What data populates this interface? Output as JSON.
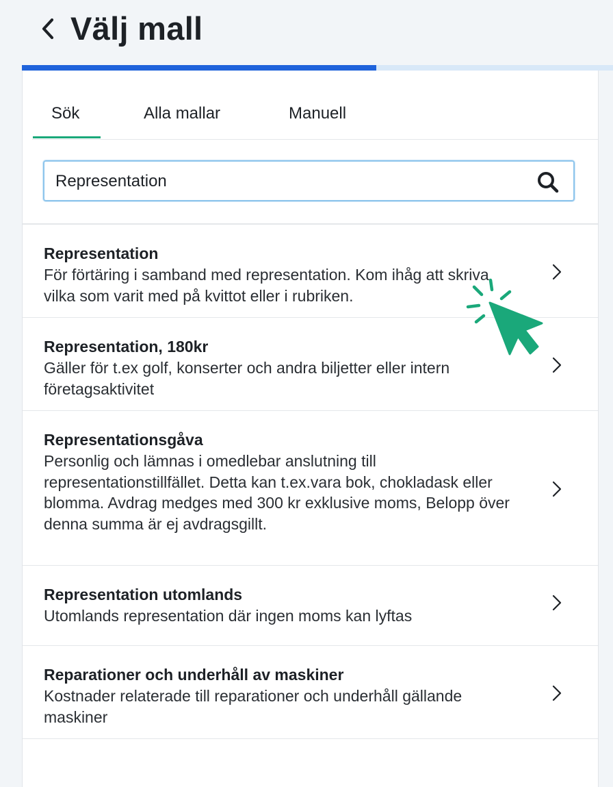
{
  "header": {
    "back_icon": "chevron-left-icon",
    "title": "Välj mall",
    "progress": 0.6
  },
  "tabs": [
    {
      "label": "Sök",
      "active": true
    },
    {
      "label": "Alla mallar",
      "active": false
    },
    {
      "label": "Manuell",
      "active": false
    }
  ],
  "search": {
    "value": "Representation",
    "placeholder": "",
    "icon": "search-icon"
  },
  "results": [
    {
      "title": "Representation",
      "description": "För förtäring i samband med representation. Kom ihåg att skriva vilka som varit med på kvittot eller i rubriken."
    },
    {
      "title": "Representation, 180kr",
      "description": "Gäller för t.ex golf, konserter och andra biljetter eller intern företagsaktivitet"
    },
    {
      "title": "Representationsgåva",
      "description": "Personlig och lämnas i omedlebar anslutning till representationstillfället. Detta kan t.ex.vara bok, chokladask eller blomma. Avdrag medges med 300 kr exklusive moms, Belopp över denna summa är ej avdragsgillt."
    },
    {
      "title": "Representation utomlands",
      "description": "Utomlands representation där ingen moms kan lyftas"
    },
    {
      "title": "Reparationer och underhåll av maskiner",
      "description": "Kostnader relaterade till reparationer och underhåll gällande maskiner"
    }
  ],
  "colors": {
    "accent_green": "#1aa87a",
    "progress_blue": "#1f63db",
    "progress_track": "#d8e8f8",
    "search_border": "#8ec5ec"
  },
  "cursor_icon": "click-pointer-icon"
}
